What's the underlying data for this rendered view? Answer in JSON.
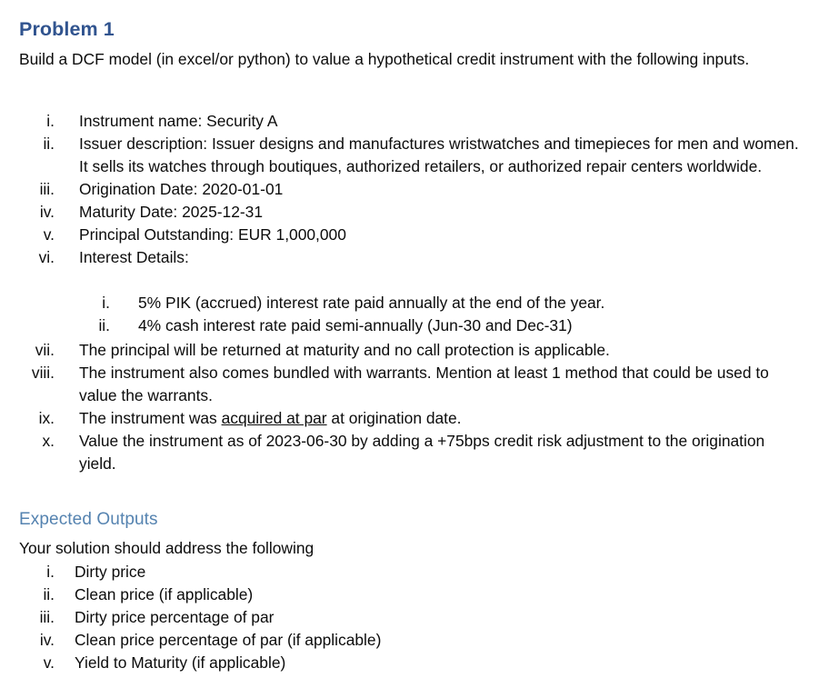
{
  "colors": {
    "heading1": "#31548F",
    "heading2": "#5583B0",
    "body_text": "#0c0c0c",
    "page_background": "#ffffff"
  },
  "problem": {
    "heading": "Problem 1",
    "intro": "Build a DCF model (in excel/or python) to value a hypothetical credit instrument with the following inputs.",
    "items": [
      {
        "marker": "i.",
        "text": "Instrument name: Security A"
      },
      {
        "marker": "ii.",
        "text": "Issuer description: Issuer designs and manufactures wristwatches and timepieces for men and women. It sells its watches through boutiques, authorized retailers, or authorized repair centers worldwide."
      },
      {
        "marker": "iii.",
        "text": "Origination Date: 2020-01-01"
      },
      {
        "marker": "iv.",
        "text": "Maturity Date: 2025-12-31"
      },
      {
        "marker": "v.",
        "text": "Principal Outstanding: EUR 1,000,000"
      },
      {
        "marker": "vi.",
        "text": "Interest Details:"
      },
      {
        "marker": "vii.",
        "text": "The principal will be returned at maturity and no call protection is applicable."
      },
      {
        "marker": "viii.",
        "text": "The instrument also comes bundled with warrants. Mention at least 1 method that could be used to value the warrants."
      },
      {
        "marker": "ix.",
        "text_before": "The instrument was ",
        "text_underlined": "acquired at par",
        "text_after": " at origination date."
      },
      {
        "marker": "x.",
        "text": "Value the instrument as of 2023-06-30 by adding a +75bps credit risk adjustment to the origination yield."
      }
    ],
    "interest_details": [
      {
        "marker": "i.",
        "text": "5% PIK (accrued) interest rate paid annually at the end of the year."
      },
      {
        "marker": "ii.",
        "text": "4% cash interest rate paid semi-annually (Jun-30 and Dec-31)"
      }
    ]
  },
  "expected_outputs": {
    "heading": "Expected Outputs",
    "intro": "Your solution should address the following",
    "items": [
      {
        "marker": "i.",
        "text": "Dirty price"
      },
      {
        "marker": "ii.",
        "text": "Clean price (if applicable)"
      },
      {
        "marker": "iii.",
        "text": "Dirty price percentage of par"
      },
      {
        "marker": "iv.",
        "text": "Clean price percentage of par (if applicable)"
      },
      {
        "marker": "v.",
        "text": "Yield to Maturity (if applicable)"
      }
    ]
  }
}
